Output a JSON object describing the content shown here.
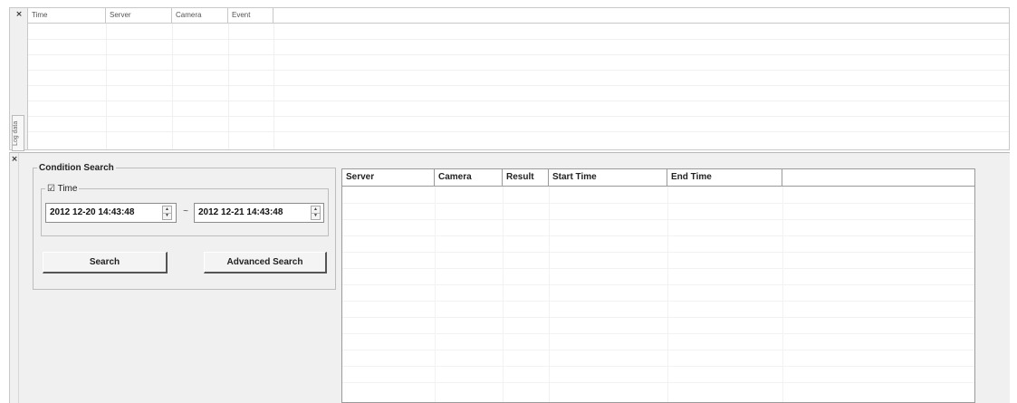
{
  "log_panel": {
    "close_glyph": "×",
    "side_tab_label": "Log data",
    "columns": [
      "Time",
      "Server",
      "Camera",
      "Event"
    ]
  },
  "search_panel": {
    "close_glyph": "×",
    "condition_group_label": "Condition Search",
    "time_group": {
      "checkbox_glyph": "☑",
      "checked": true,
      "label": "Time",
      "start": "2012 12-20 14:43:48",
      "separator": "~",
      "end": "2012 12-21 14:43:48"
    },
    "search_button": "Search",
    "advanced_search_button": "Advanced Search"
  },
  "results_table": {
    "columns": [
      "Server",
      "Camera",
      "Result",
      "Start Time",
      "End Time"
    ],
    "rows": []
  },
  "icons": {
    "spin_up": "▲",
    "spin_down": "▼"
  },
  "colors": {
    "panel_background": "#f0f0f0",
    "border": "#c8c8c8",
    "button_shadow": "#555555"
  }
}
